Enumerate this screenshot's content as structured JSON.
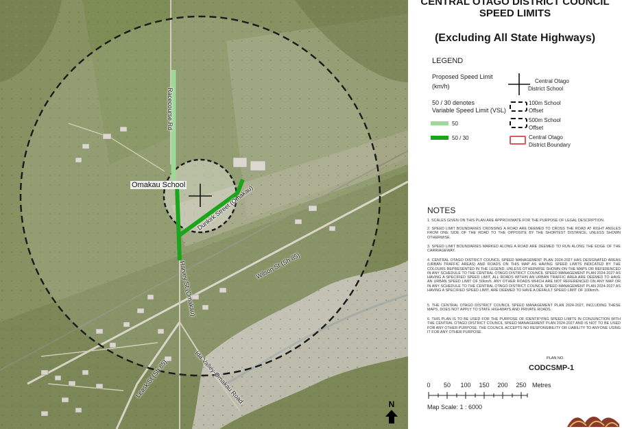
{
  "header": {
    "title_line1": "CENTRAL OTAGO DISTRICT COUNCIL",
    "title_line2": "SPEED LIMITS",
    "subtitle": "(Excluding All State Highways)"
  },
  "legend": {
    "heading": "LEGEND",
    "proposed_line1": "Proposed Speed Limit",
    "proposed_line2": "(km/h)",
    "vsl_line1": "50 / 30 denotes",
    "vsl_line2": "Variable Speed Limit (VSL)",
    "item_50": "50",
    "item_50_30": "50 / 30",
    "school_line1": "Central Otago",
    "school_line2": "District School",
    "offset100_line1": "100m School",
    "offset100_line2": "Offset",
    "offset500_line1": "500m School",
    "offset500_line2": "Offset",
    "boundary_line1": "Central Otago",
    "boundary_line2": "District Boundary",
    "colors": {
      "speed_50": "#9fd99a",
      "speed_50_30": "#1aa51a",
      "district_boundary": "#e05555"
    }
  },
  "notes": {
    "heading": "NOTES",
    "items": [
      "1. SCALES GIVEN ON THIS PLAN ARE APPROXIMATE FOR THE PURPOSE OF LEGAL DESCRIPTION.",
      "2. SPEED LIMIT BOUNDARIES CROSSING A ROAD ARE DEEMED TO CROSS THE ROAD AT RIGHT ANGLES FROM ONE SIDE OF THE ROAD TO THE OPPOSITE BY THE SHORTEST DISTANCE, UNLESS SHOWN OTHERWISE.",
      "3. SPEED LIMIT BOUNDARIES MARKED ALONG A ROAD ARE DEEMED TO RUN ALONG THE EDGE OF THE CARRIAGEWAY.",
      "4. CENTRAL OTAGO DISTRICT COUNCIL SPEED MANAGEMENT PLAN 2024-2027 HAS DESIGNATED AREAS (URBAN TRAFFIC AREAS) AND ROADS ON THIS MAP AS HAVING SPEED LIMITS INDICATED BY THE COLOURS REPRESENTED IN THE LEGEND. UNLESS OTHERWISE SHOWN ON THE MAPS OR REFERENCED IN ANY SCHEDULE TO THE CENTRAL OTAGO DISTRICT COUNCIL SPEED MANAGEMENT PLAN 2024-2027 AS HAVING A SPECIFIED SPEED LIMIT, ALL ROADS WITHIN AN URBAN TRAFFIC AREA ARE DEEMED TO HAVE AN URBAN SPEED LIMIT OF 50km/h. ANY OTHER ROADS WHICH ARE NOT REFERENCED ON ANY MAP OR IN ANY SCHEDULE TO THE CENTRAL OTAGO DISTRICT COUNCIL SPEED MANAGEMENT PLAN 2024-2027 AS HAVING A SPECIFIED SPEED LIMIT, ARE DEEMED TO HAVE A DEFAULT SPEED LIMIT OF 100km/h.",
      "5. THE CENTRAL OTAGO DISTRICT COUNCIL SPEED MANAGEMENT PLAN 2024-2027, INCLUDING THESE MAPS, DOES NOT APPLY TO STATE HIGHWAYS AND PRIVATE ROADS.",
      "6. THIS PLAN IS TO BE USED FOR THE PURPOSE OF IDENTIFYING SPEED LIMITS IN CONJUNCTION WITH THE CENTRAL OTAGO DISTRICT COUNCIL SPEED MANAGEMENT PLAN 2024-2027 AND IS NOT TO BE USED FOR ANY OTHER PURPOSE. THE COUNCIL ACCEPTS NO RESPONSIBILITY OR LIABILITY TO ANYONE USING IT FOR ANY OTHER PURPOSE."
    ]
  },
  "plan": {
    "label": "PLAN NO.",
    "number": "CODCSMP-1"
  },
  "scale": {
    "ticks": [
      "0",
      "50",
      "100",
      "150",
      "200",
      "250"
    ],
    "unit": "Metres",
    "text": "Map Scale: 1 : 6000"
  },
  "map": {
    "school_label": "Omakau School",
    "roads": {
      "racecourse": "Racecourse Rd",
      "dunkirk": "Dunkirk Street (Omakau)",
      "harvey": "Harvey St (Omakau)",
      "wilson": "Wilson St (Sh 85)",
      "leask": "Leask St (Sh 85)",
      "ida_valley": "Ida Valley-Omakau Road"
    },
    "north_letter": "N",
    "icons": [
      "north-arrow-icon",
      "school-cross-icon",
      "council-logo-icon"
    ]
  }
}
